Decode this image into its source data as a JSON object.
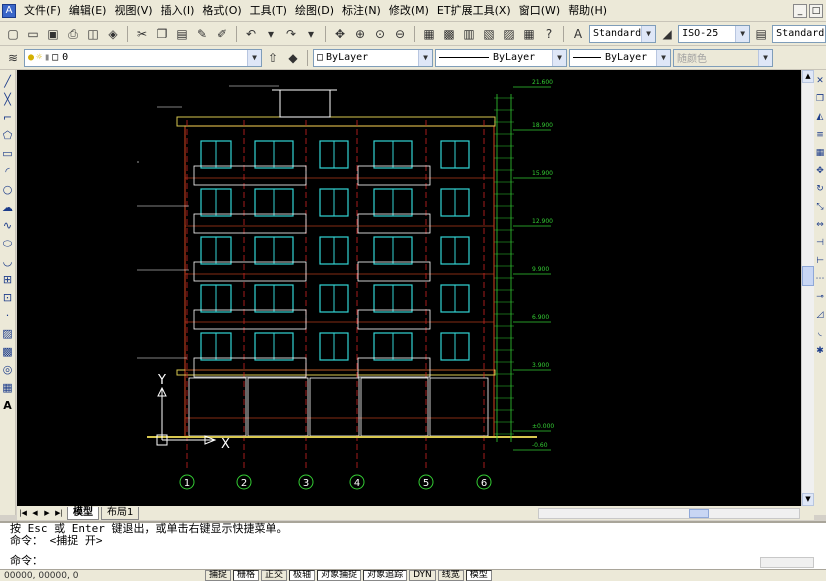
{
  "menubar": {
    "items": [
      "文件(F)",
      "编辑(E)",
      "视图(V)",
      "插入(I)",
      "格式(O)",
      "工具(T)",
      "绘图(D)",
      "标注(N)",
      "修改(M)",
      "ET扩展工具(X)",
      "窗口(W)",
      "帮助(H)"
    ],
    "window_controls": [
      "_",
      "□"
    ]
  },
  "standard_toolbar": {
    "text_style": "Standard",
    "dim_style": "ISO-25",
    "table_style": "Standard"
  },
  "layers_toolbar": {
    "layer": "0",
    "color": "ByLayer",
    "linetype": "ByLayer",
    "lineweight": "ByLayer",
    "plotstyle": "随颜色"
  },
  "drawing": {
    "axis_labels": [
      "1",
      "2",
      "3",
      "4",
      "5",
      "6"
    ],
    "elevations": [
      "21.600",
      "18.900",
      "15.900",
      "12.900",
      "9.900",
      "6.900",
      "3.900",
      "±0.000",
      "-0.60"
    ],
    "ucs_y": "Y",
    "ucs_x": "X",
    "colors": {
      "background": "#000000",
      "wall": "#b03a1a",
      "window": "#33d4d4",
      "dim": "#33cc33",
      "axis": "#cc2222",
      "text": "#ffffff",
      "parapet": "#d8c850"
    }
  },
  "tabs": {
    "model": "模型",
    "layout1": "布局1"
  },
  "command": {
    "line1": "按 Esc 或 Enter 键退出，或单击右键显示快捷菜单。",
    "line2": "命令：  <捕捉 开>",
    "line3": "命令："
  },
  "status": {
    "coords": "00000, 00000, 0",
    "buttons": [
      "捕捉",
      "栅格",
      "正交",
      "极轴",
      "对象捕捉",
      "对象追踪",
      "DYN",
      "线宽",
      "模型"
    ]
  }
}
